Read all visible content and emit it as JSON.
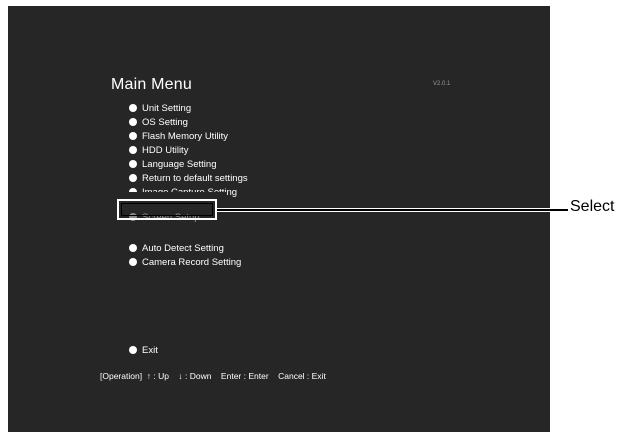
{
  "screen": {
    "title": "Main Menu",
    "version": "V2.0.1",
    "menu_items": [
      {
        "label": "Unit Setting"
      },
      {
        "label": "OS Setting"
      },
      {
        "label": "Flash Memory Utility"
      },
      {
        "label": "HDD Utility"
      },
      {
        "label": "Language Setting"
      },
      {
        "label": "Return to default settings"
      },
      {
        "label": "Image Capture Setting"
      },
      {
        "label": "Screen Setup"
      },
      {
        "label": "Auto Detect Setting"
      },
      {
        "label": "Camera Record Setting"
      },
      {
        "label": "Exit"
      }
    ],
    "footer": "[Operation]  ↑ : Up    ↓ : Down    Enter : Enter    Cancel : Exit"
  },
  "callout": {
    "label": "Select"
  },
  "colors": {
    "screen_bg": "#262626",
    "text": "#ffffff",
    "selected_text": "#9a9a9a"
  }
}
